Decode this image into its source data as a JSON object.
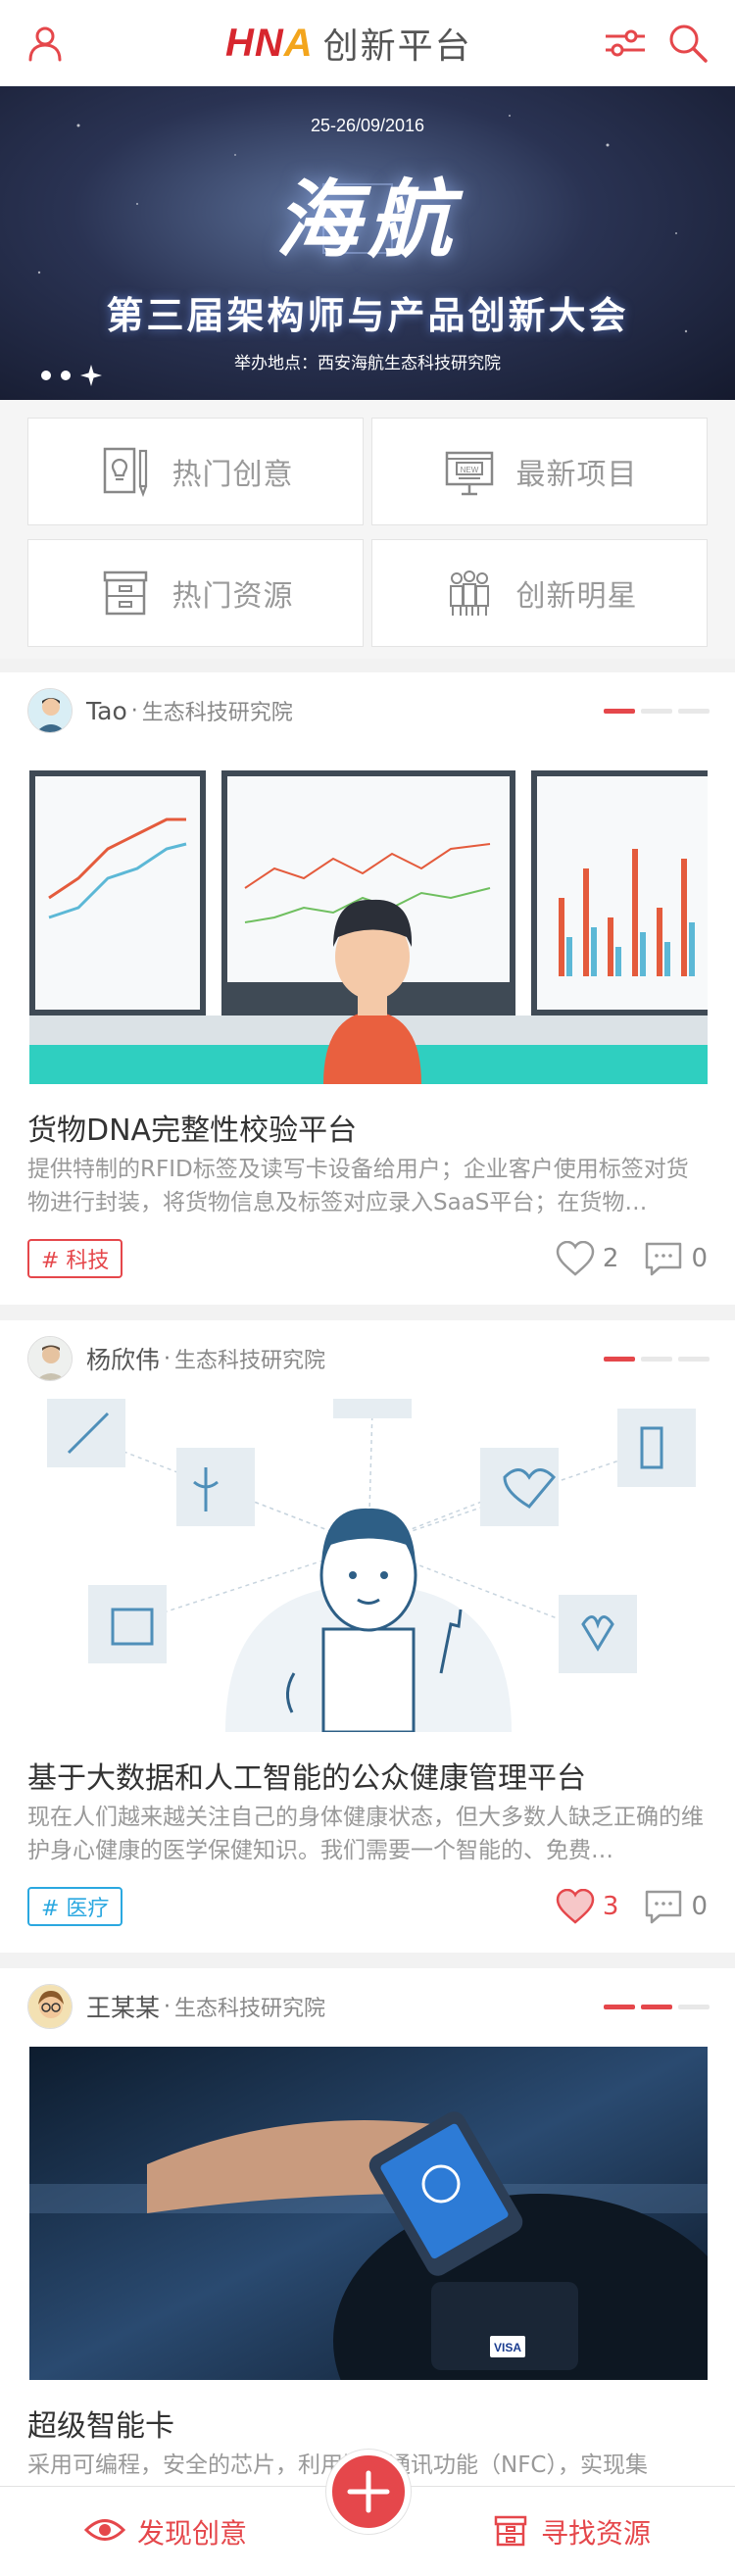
{
  "header": {
    "logo_text": "HNA",
    "brand_name": "创新平台",
    "accent_color": "#e5474b",
    "left_icon": "user-icon",
    "right_icons": [
      "filter-sliders-icon",
      "search-icon"
    ]
  },
  "banner": {
    "date": "25-26/09/2016",
    "headline": "海航",
    "subtitle": "第三届架构师与产品创新大会",
    "venue": "举办地点：西安海航生态科技研究院",
    "slide_count": 3
  },
  "quick_nav": [
    {
      "label": "热门创意",
      "icon": "idea-bulb-icon"
    },
    {
      "label": "最新项目",
      "icon": "new-board-icon"
    },
    {
      "label": "热门资源",
      "icon": "archive-box-icon"
    },
    {
      "label": "创新明星",
      "icon": "team-people-icon"
    }
  ],
  "feed": [
    {
      "author": "Tao",
      "org": "生态科技研究院",
      "title": "货物DNA完整性校验平台",
      "desc": "提供特制的RFID标签及读写卡设备给用户；企业客户使用标签对货物进行封装，将货物信息及标签对应录入SaaS平台；在货物…",
      "tag": "# 科技",
      "tag_color": "red",
      "likes": "2",
      "comments": "0",
      "liked": false
    },
    {
      "author": "杨欣伟",
      "org": "生态科技研究院",
      "title": "基于大数据和人工智能的公众健康管理平台",
      "desc": "现在人们越来越关注自己的身体健康状态，但大多数人缺乏正确的维护身心健康的医学保健知识。我们需要一个智能的、免费…",
      "tag": "# 医疗",
      "tag_color": "blue",
      "likes": "3",
      "comments": "0",
      "liked": true
    },
    {
      "author": "王某某",
      "org": "生态科技研究院",
      "title": "超级智能卡",
      "desc": "采用可编程，安全的芯片，利用近场通讯功能（NFC），实现集"
    }
  ],
  "tabbar": {
    "left_label": "发现创意",
    "left_icon": "eye-icon",
    "center_icon": "plus-icon",
    "right_label": "寻找资源",
    "right_icon": "resource-box-icon"
  }
}
